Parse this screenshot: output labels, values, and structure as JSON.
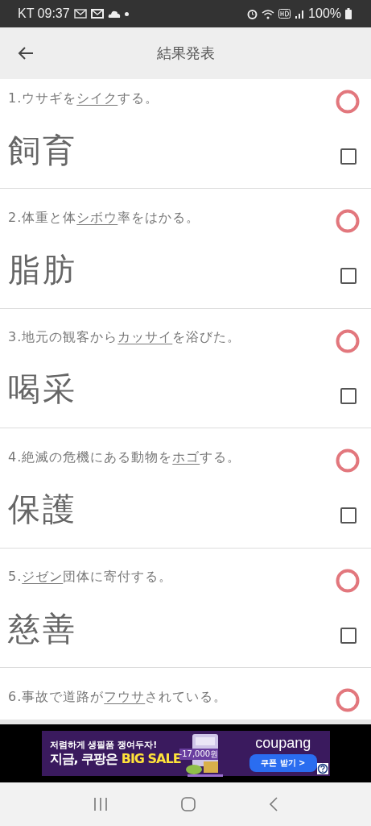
{
  "status_bar": {
    "carrier_time": "KT 09:37",
    "battery": "100%"
  },
  "app_bar": {
    "title": "結果発表"
  },
  "questions": [
    {
      "number": "1.",
      "before": "ウサギを",
      "underlined": "シイク",
      "after": "する。",
      "answer": "飼育",
      "correct": true,
      "checked": false
    },
    {
      "number": "2.",
      "before": "体重と体",
      "underlined": "シボウ",
      "after": "率をはかる。",
      "answer": "脂肪",
      "correct": true,
      "checked": false
    },
    {
      "number": "3.",
      "before": "地元の観客から",
      "underlined": "カッサイ",
      "after": "を浴びた。",
      "answer": "喝采",
      "correct": true,
      "checked": false
    },
    {
      "number": "4.",
      "before": "絶滅の危機にある動物を",
      "underlined": "ホゴ",
      "after": "する。",
      "answer": "保護",
      "correct": true,
      "checked": false
    },
    {
      "number": "5.",
      "underlined": "ジゼン",
      "after": "団体に寄付する。",
      "answer": "慈善",
      "correct": true,
      "checked": false
    },
    {
      "number": "6.",
      "before": "事故で道路が",
      "underlined": "フウサ",
      "after": "されている。",
      "correct": true
    }
  ],
  "ad": {
    "tagline": "저렴하게 생필품 쟁여두자!",
    "headline": "지금, 쿠팡은",
    "sale": "BIG SALE",
    "price": "-17,000원",
    "brand": "coupang",
    "button": "쿠폰 받기 >"
  }
}
